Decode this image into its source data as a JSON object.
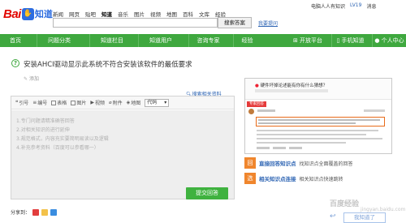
{
  "header": {
    "logo_bai": "Bai",
    "logo_paw": "du",
    "logo_zhidao": "知道",
    "nav": [
      "新闻",
      "网页",
      "贴吧",
      "知道",
      "音乐",
      "图片",
      "视频",
      "地图",
      "百科",
      "文库",
      "经验"
    ],
    "active_nav": "知道",
    "search_value": "",
    "search_button": "搜索答案",
    "ask_link": "我要提问",
    "user_name": "电脑人人有知识",
    "user_level": "LV19",
    "user_more": "消息"
  },
  "greenbar": {
    "tabs": [
      "首页",
      "问题分类",
      "知道栏目",
      "知道用户",
      "咨询专家",
      "经验",
      "开放平台",
      "手机知道",
      "个人中心"
    ],
    "bg_color": "#3fa83f"
  },
  "question": {
    "title": "安装AHCI驱动显示此系统不符合安装该软件的最低要求",
    "add_tag": "添加",
    "search_related": "搜索相关资料"
  },
  "editor": {
    "toolbar": [
      "引号",
      "编号",
      "表格",
      "图片",
      "视频",
      "附件",
      "地图",
      "代码"
    ],
    "code_select": "代码",
    "hints": [
      "1.专门问题请精准确答回答",
      "2.对相关知识的进行延伸",
      "3.规范格式，内容充实要简明易读以及逻辑",
      "4.补充参考资料（百度可以参看哪一）"
    ],
    "submit": "提交回答",
    "share_label": "分享到："
  },
  "right_panel": {
    "preview_question": "硬件坏掉论述能有你有什么猜想？",
    "ribbon": "专家回答",
    "features": [
      {
        "icon": "回",
        "title": "直接回答知识点",
        "desc": "找知识点全面覆盖的回答"
      },
      {
        "icon": "选",
        "title": "相关知识点连接",
        "desc": "相关知识点快速跳转"
      }
    ],
    "ok_button": "我知道了",
    "watermark": "百度经验",
    "watermark_sub": "jingyan.baidu.com"
  }
}
